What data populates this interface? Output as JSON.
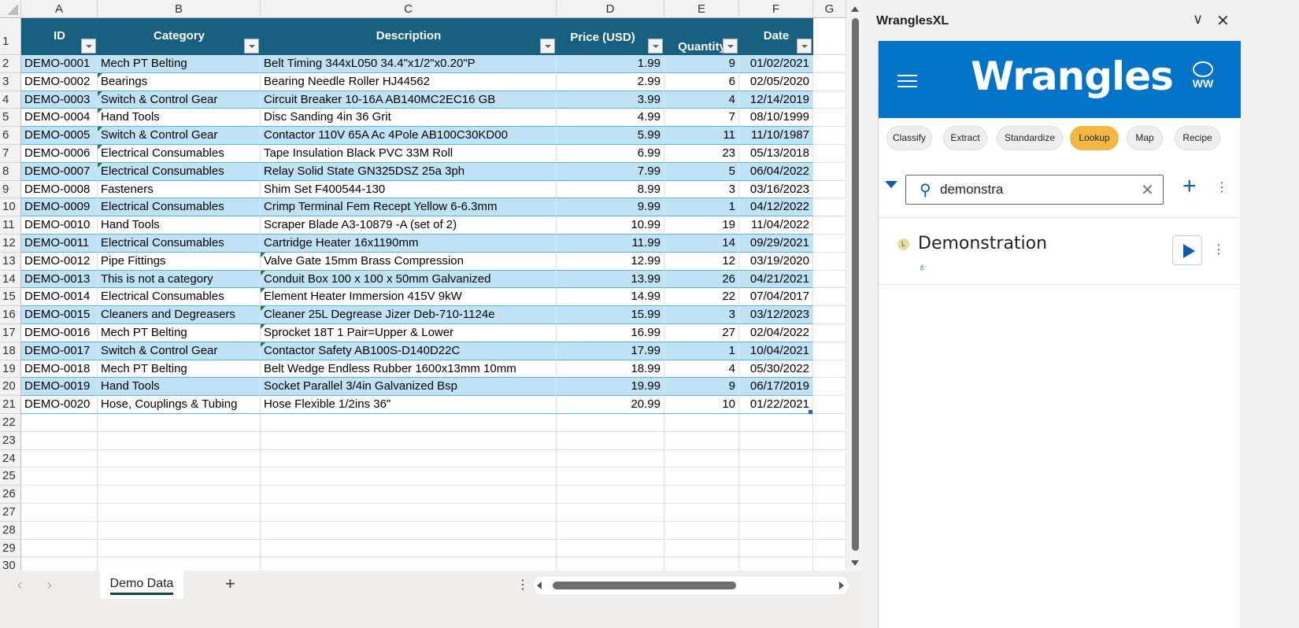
{
  "sheet": {
    "columns": [
      "A",
      "B",
      "C",
      "D",
      "E",
      "F",
      "G"
    ],
    "headers": [
      "ID",
      "Category",
      "Description",
      "Price (USD)",
      "Quantity",
      "Date"
    ],
    "rows": [
      [
        "DEMO-0001",
        "Mech PT Belting",
        "Belt Timing 344xL050 34.4\"x1/2\"x0.20\"P",
        "1.99",
        "9",
        "01/02/2021"
      ],
      [
        "DEMO-0002",
        "Bearings",
        "Bearing Needle Roller HJ44562",
        "2.99",
        "6",
        "02/05/2020"
      ],
      [
        "DEMO-0003",
        "Switch & Control Gear",
        "Circuit Breaker 10-16A AB140MC2EC16 GB",
        "3.99",
        "4",
        "12/14/2019"
      ],
      [
        "DEMO-0004",
        "Hand Tools",
        "Disc Sanding 4in 36 Grit",
        "4.99",
        "7",
        "08/10/1999"
      ],
      [
        "DEMO-0005",
        "Switch & Control Gear",
        "Contactor 110V 65A Ac 4Pole AB100C30KD00",
        "5.99",
        "11",
        "11/10/1987"
      ],
      [
        "DEMO-0006",
        "Electrical Consumables",
        "Tape Insulation Black PVC 33M Roll",
        "6.99",
        "23",
        "05/13/2018"
      ],
      [
        "DEMO-0007",
        "Electrical Consumables",
        "Relay Solid State GN325DSZ 25a 3ph",
        "7.99",
        "5",
        "06/04/2022"
      ],
      [
        "DEMO-0008",
        "Fasteners",
        "Shim Set F400544-130",
        "8.99",
        "3",
        "03/16/2023"
      ],
      [
        "DEMO-0009",
        "Electrical Consumables",
        "Crimp Terminal Fem Recept Yellow 6-6.3mm",
        "9.99",
        "1",
        "04/12/2022"
      ],
      [
        "DEMO-0010",
        "Hand Tools",
        "Scraper Blade A3-10879 -A (set of 2)",
        "10.99",
        "19",
        "11/04/2022"
      ],
      [
        "DEMO-0011",
        "Electrical Consumables",
        "Cartridge Heater 16x1190mm",
        "11.99",
        "14",
        "09/29/2021"
      ],
      [
        "DEMO-0012",
        "Pipe Fittings",
        "Valve Gate 15mm Brass Compression",
        "12.99",
        "12",
        "03/19/2020"
      ],
      [
        "DEMO-0013",
        "This is not a category",
        "Conduit Box 100 x 100 x 50mm Galvanized",
        "13.99",
        "26",
        "04/21/2021"
      ],
      [
        "DEMO-0014",
        "Electrical Consumables",
        "Element Heater Immersion 415V 9kW",
        "14.99",
        "22",
        "07/04/2017"
      ],
      [
        "DEMO-0015",
        "Cleaners and Degreasers",
        "Cleaner 25L Degrease Jizer Deb-710-1124e",
        "15.99",
        "3",
        "03/12/2023"
      ],
      [
        "DEMO-0016",
        "Mech PT Belting",
        "Sprocket 18T 1 Pair=Upper & Lower",
        "16.99",
        "27",
        "02/04/2022"
      ],
      [
        "DEMO-0017",
        "Switch & Control Gear",
        "Contactor Safety AB100S-D140D22C",
        "17.99",
        "1",
        "10/04/2021"
      ],
      [
        "DEMO-0018",
        "Mech PT Belting",
        "Belt Wedge Endless Rubber 1600x13mm 10mm",
        "18.99",
        "4",
        "05/30/2022"
      ],
      [
        "DEMO-0019",
        "Hand Tools",
        "Socket Parallel 3/4in Galvanized Bsp",
        "19.99",
        "9",
        "06/17/2019"
      ],
      [
        "DEMO-0020",
        "Hose, Couplings & Tubing",
        "Hose Flexible 1/2ins 36\"",
        "20.99",
        "10",
        "01/22/2021"
      ]
    ],
    "row_numbers": [
      "1",
      "2",
      "3",
      "4",
      "5",
      "6",
      "7",
      "8",
      "9",
      "10",
      "11",
      "12",
      "13",
      "14",
      "15",
      "16",
      "17",
      "18",
      "19",
      "20",
      "21",
      "22",
      "23",
      "24",
      "25",
      "26",
      "27",
      "28",
      "29",
      "30"
    ],
    "header_color": "#17607f",
    "band_color": "#bfe3f4"
  },
  "tabs": {
    "active": "Demo Data",
    "add": "+"
  },
  "pane": {
    "title": "WranglesXL",
    "logo_text": "Wrangles",
    "logo_badge": "WW",
    "brand_color": "#0174c9",
    "chips": [
      {
        "label": "Classify"
      },
      {
        "label": "Extract"
      },
      {
        "label": "Standardize"
      },
      {
        "label": "Lookup",
        "active": true
      },
      {
        "label": "Map"
      },
      {
        "label": "Recipe"
      }
    ],
    "active_chip_color": "#f2b843",
    "search": {
      "value": "demonstra"
    },
    "result": {
      "badge": "L",
      "name": "Demonstration"
    }
  }
}
